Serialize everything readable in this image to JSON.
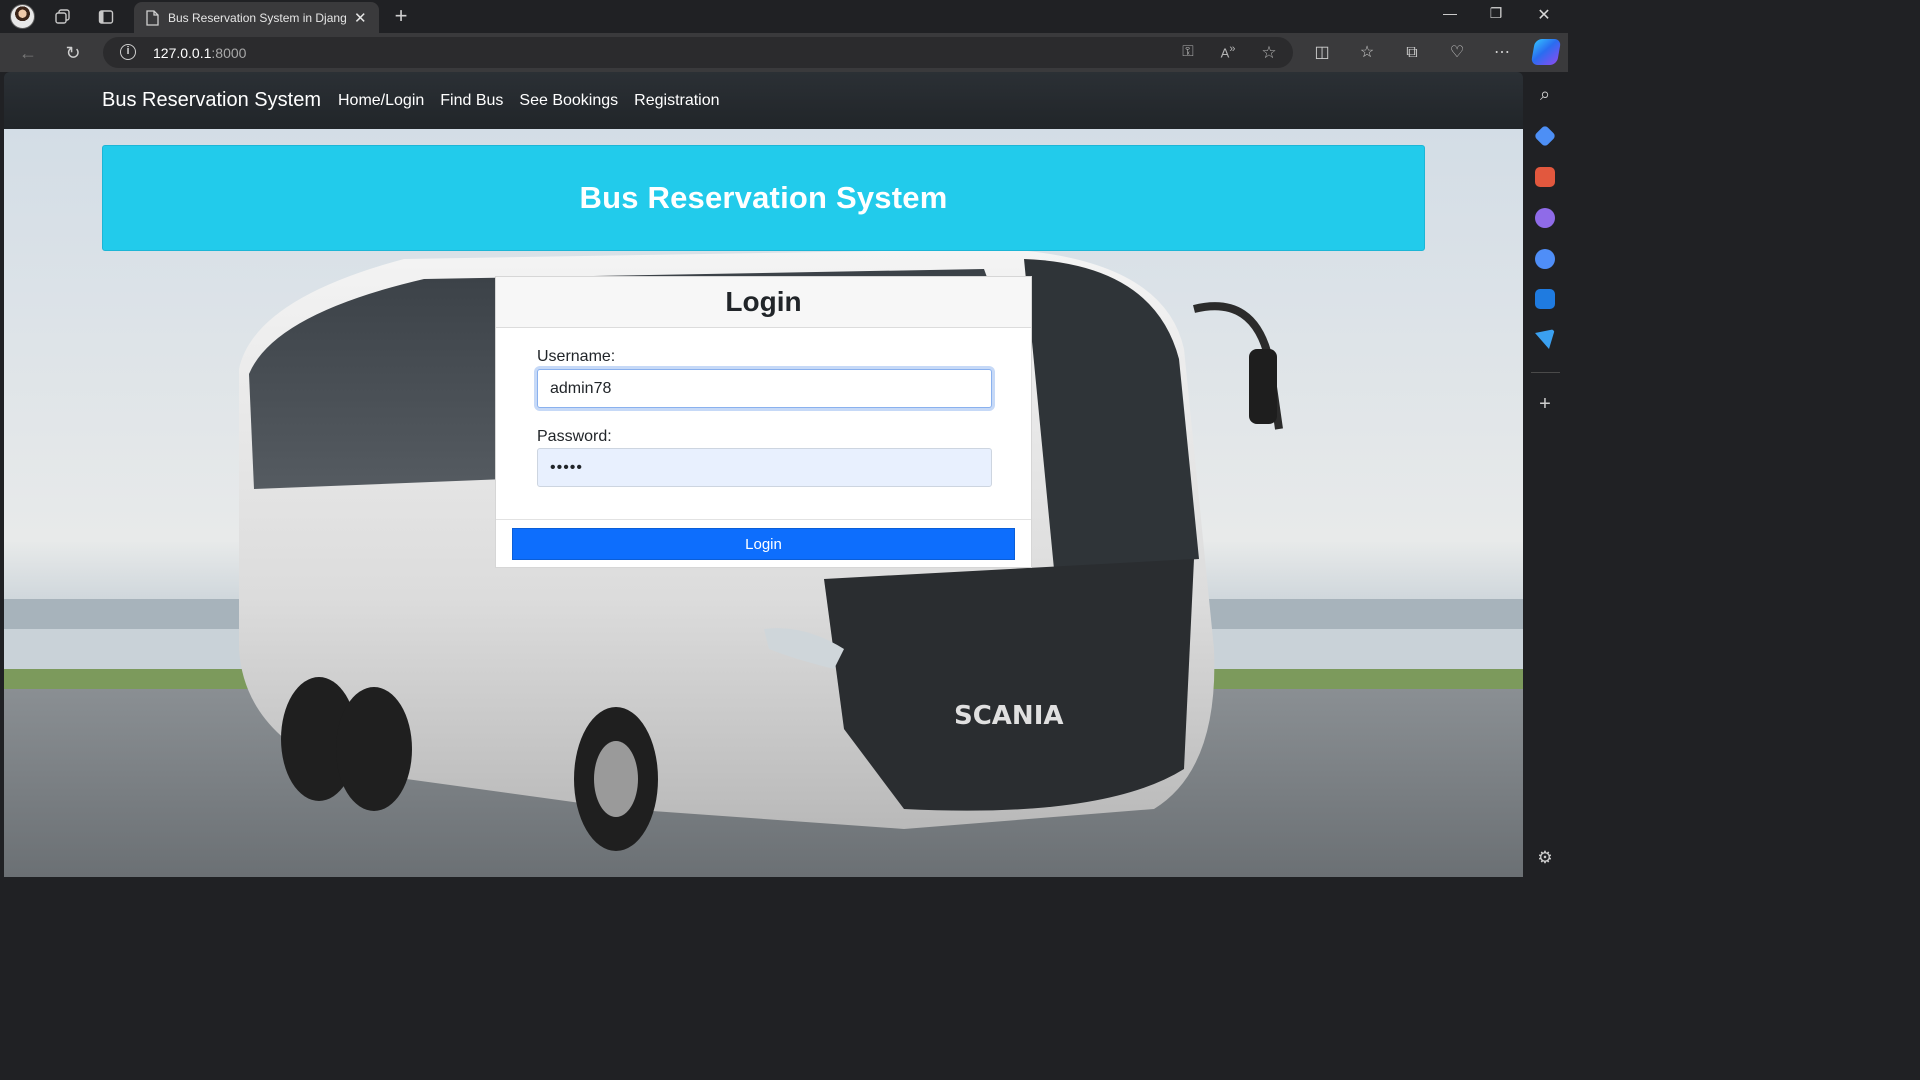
{
  "browser": {
    "tab_title": "Bus Reservation System in Djang",
    "url_host": "127.0.0.1",
    "url_port": ":8000"
  },
  "navbar": {
    "brand": "Bus Reservation System",
    "links": [
      {
        "label": "Home/Login"
      },
      {
        "label": "Find Bus"
      },
      {
        "label": "See Bookings"
      },
      {
        "label": "Registration"
      }
    ]
  },
  "banner": {
    "title": "Bus Reservation System"
  },
  "login": {
    "title": "Login",
    "username_label": "Username:",
    "username_value": "admin78",
    "password_label": "Password:",
    "password_value": "•••••",
    "button_label": "Login"
  },
  "hero": {
    "bus_brand": "SCANIA"
  },
  "colors": {
    "navbar": "#212529",
    "banner": "#22cbeb",
    "primary_button": "#0d6efd",
    "autofill": "#e8f0fe"
  }
}
